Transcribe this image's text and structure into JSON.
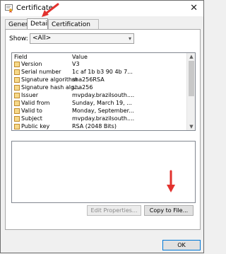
{
  "window": {
    "title": "Certificate",
    "close_glyph": "✕"
  },
  "tabs": [
    {
      "label": "General"
    },
    {
      "label": "Details",
      "active": true
    },
    {
      "label": "Certification Path"
    }
  ],
  "show": {
    "label": "Show:",
    "selected": "<All>"
  },
  "list": {
    "columns": [
      "Field",
      "Value"
    ],
    "rows": [
      {
        "field": "Version",
        "value": "V3"
      },
      {
        "field": "Serial number",
        "value": "1c af 1b b3 90 4b 7..."
      },
      {
        "field": "Signature algorithm",
        "value": "sha256RSA"
      },
      {
        "field": "Signature hash alg...",
        "value": "sha256"
      },
      {
        "field": "Issuer",
        "value": "mvpday.brazilsouth...."
      },
      {
        "field": "Valid from",
        "value": "Sunday, March 19, ..."
      },
      {
        "field": "Valid to",
        "value": "Monday, September..."
      },
      {
        "field": "Subject",
        "value": "mvpday.brazilsouth...."
      },
      {
        "field": "Public key",
        "value": "RSA (2048 Bits)"
      }
    ]
  },
  "buttons": {
    "edit_properties": "Edit Properties...",
    "copy_to_file": "Copy to File...",
    "ok": "OK"
  },
  "colors": {
    "annotation_arrow": "#e2322e"
  }
}
